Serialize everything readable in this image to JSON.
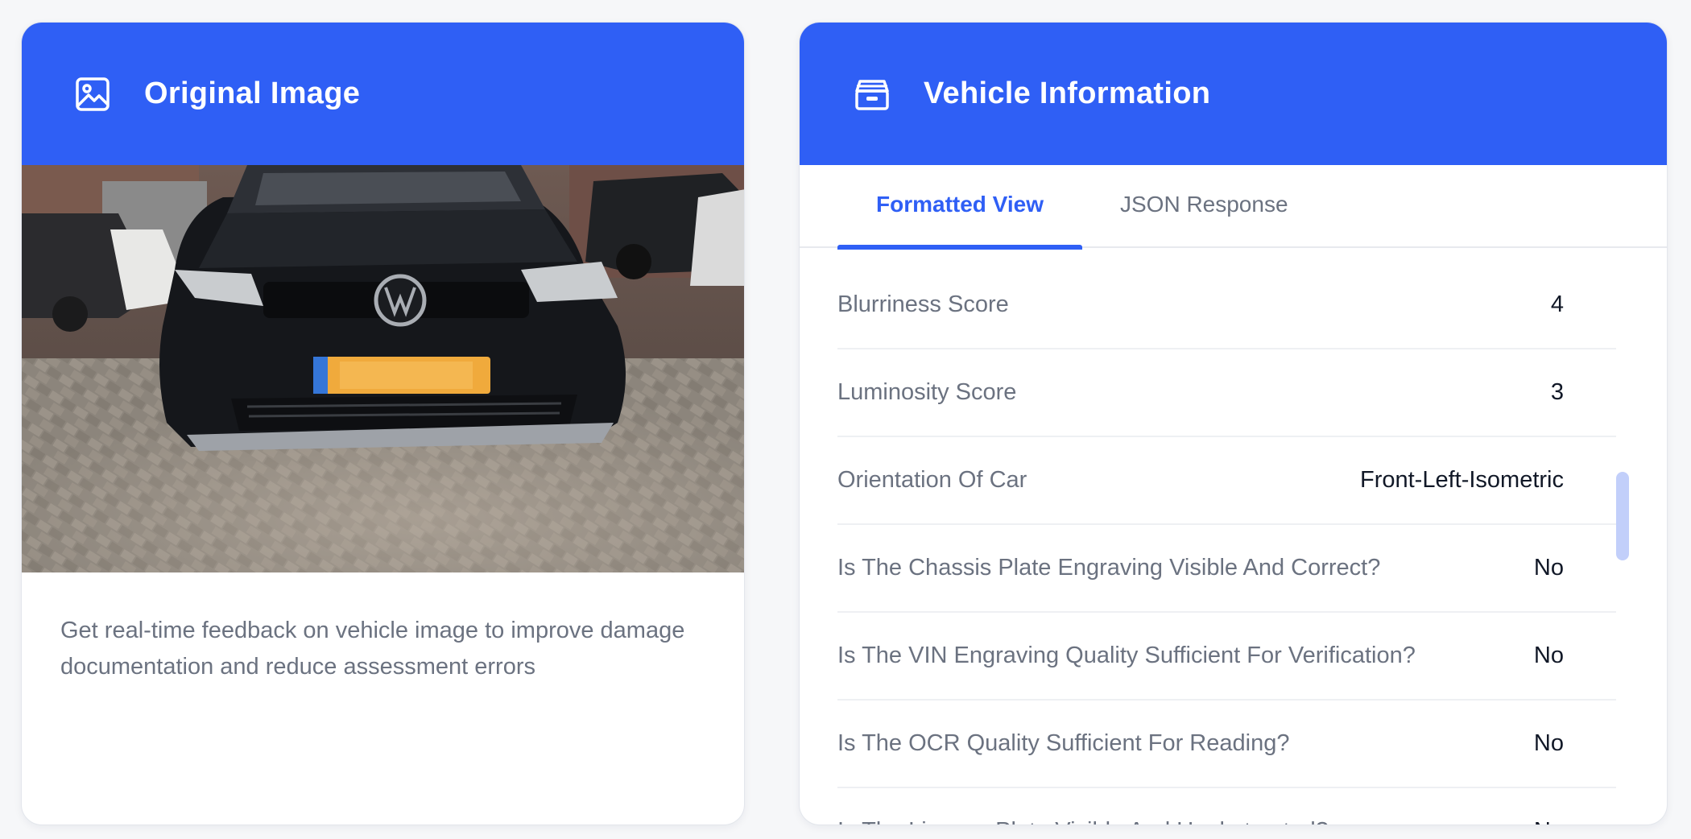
{
  "left_card": {
    "title": "Original Image",
    "description": "Get real-time feedback on vehicle image to improve damage documentation and reduce assessment errors",
    "icon": "image-icon"
  },
  "right_card": {
    "title": "Vehicle Information",
    "icon": "archive-box-icon",
    "tabs": [
      {
        "label": "Formatted View",
        "active": true
      },
      {
        "label": "JSON Response",
        "active": false
      }
    ],
    "rows": [
      {
        "label": "Blurriness Score",
        "value": "4"
      },
      {
        "label": "Luminosity Score",
        "value": "3"
      },
      {
        "label": "Orientation Of Car",
        "value": "Front-Left-Isometric"
      },
      {
        "label": "Is The Chassis Plate Engraving Visible And Correct?",
        "value": "No"
      },
      {
        "label": "Is The VIN Engraving Quality Sufficient For Verification?",
        "value": "No"
      },
      {
        "label": "Is The OCR Quality Sufficient For Reading?",
        "value": "No"
      },
      {
        "label": "Is The License Plate Visible And Unobstructed?",
        "value": "No"
      }
    ]
  },
  "colors": {
    "accent": "#2f5ff5",
    "text_muted": "#6b7280",
    "text_strong": "#111827"
  }
}
